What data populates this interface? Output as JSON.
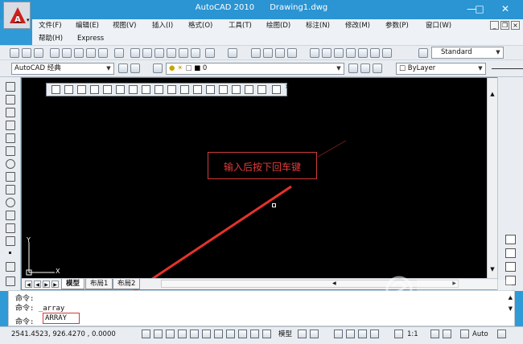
{
  "window": {
    "app_name": "AutoCAD 2010",
    "document": "Drawing1.dwg"
  },
  "menu": {
    "row1": [
      "文件(F)",
      "编辑(E)",
      "视图(V)",
      "插入(I)",
      "格式(O)",
      "工具(T)",
      "绘图(D)",
      "标注(N)",
      "修改(M)",
      "参数(P)",
      "窗口(W)"
    ],
    "row2": [
      "帮助(H)",
      "Express"
    ]
  },
  "toolbar": {
    "text_style": "Standard",
    "workspace": "AutoCAD 经典",
    "layer": "0",
    "linetype": "ByLayer"
  },
  "canvas": {
    "annotation": "输入后按下回车键",
    "ucs_x": "X",
    "ucs_y": "Y"
  },
  "tabs": [
    "模型",
    "布局1",
    "布局2"
  ],
  "command": {
    "history": [
      {
        "prompt": "命令:",
        "text": ""
      },
      {
        "prompt": "命令:",
        "text": "_array"
      }
    ],
    "current_prompt": "命令:",
    "current_input": "ARRAY"
  },
  "status": {
    "coordinates": "2541.4523, 926.4270 , 0.0000",
    "model_label": "模型",
    "scale": "1:1",
    "auto_label": "Auto"
  },
  "icons": {
    "app": "autocad-logo-icon"
  },
  "colors": {
    "title_bg": "#2b94d2",
    "canvas_bg": "#000000",
    "annotation": "#e23b3b"
  }
}
